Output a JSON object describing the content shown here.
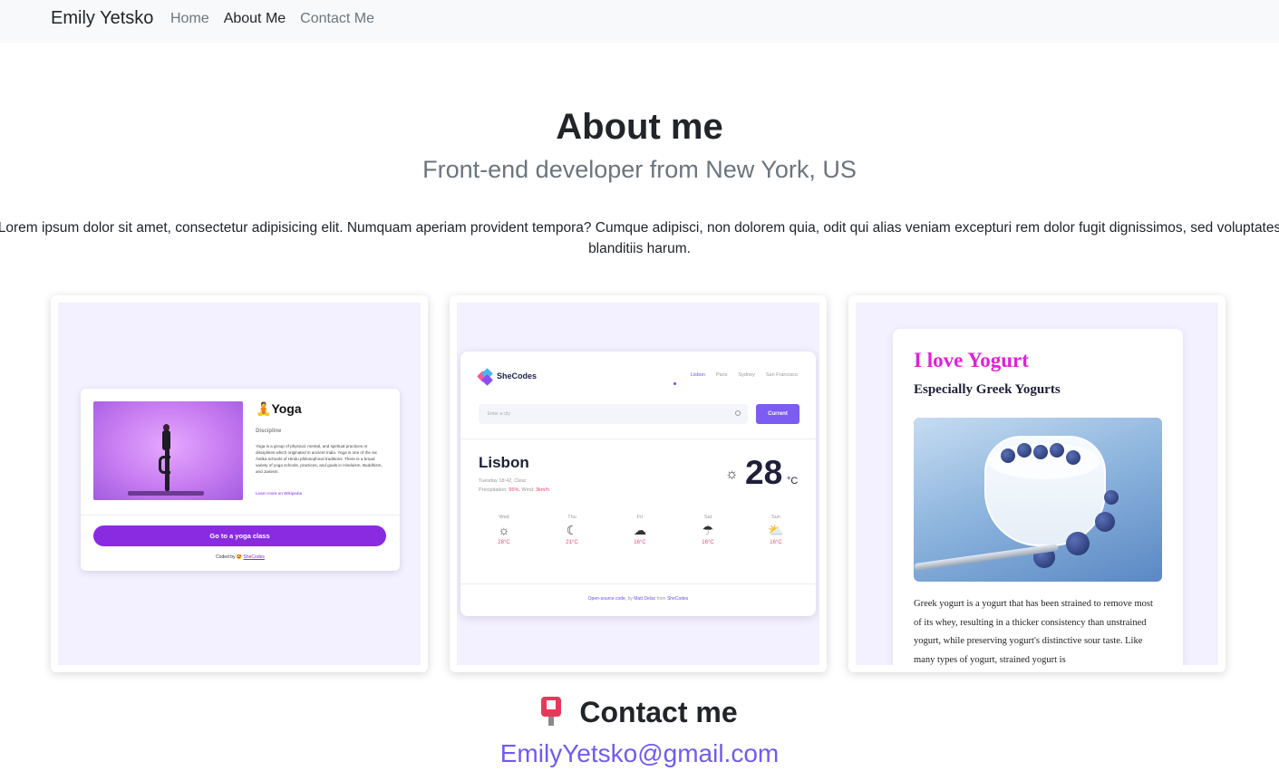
{
  "nav": {
    "brand": "Emily Yetsko",
    "links": [
      {
        "label": "Home"
      },
      {
        "label": "About Me"
      },
      {
        "label": "Contact Me"
      }
    ]
  },
  "about": {
    "title": "About me",
    "subtitle": "Front-end developer from New York, US",
    "text": "Lorem ipsum dolor sit amet, consectetur adipisicing elit. Numquam aperiam provident tempora? Cumque adipisci, non dolorem quia, odit qui alias veniam excepturi rem dolor fugit dignissimos, sed voluptates\nblanditiis harum."
  },
  "projects": {
    "yoga": {
      "title": "Yoga",
      "emoji": "🧘",
      "discipline": "Discipline",
      "description": "Yoga is a group of physical, mental, and spiritual practices or disciplines which originated in ancient India. Yoga is one of the six Āstika schools of Hindu philosophical traditions. There is a broad variety of yoga schools, practices, and goals in Hinduism, Buddhism, and Jainism.",
      "link": "Learn more on Wikipedia",
      "button": "Go to a yoga class",
      "coded_by": "Coded by",
      "coded_emoji": "🤩",
      "coded_link": "SheCodes"
    },
    "weather": {
      "brand": "SheCodes",
      "cities": [
        "Lisbon",
        "Paris",
        "Sydney",
        "San Francisco"
      ],
      "search_placeholder": "Enter a city",
      "current_button": "Current",
      "city": "Lisbon",
      "date_line": "Tuesday 18:42, Clear",
      "precip_label": "Precipitation:",
      "precip_value": "65%",
      "wind_label": ", Wind:",
      "wind_value": "3km/h",
      "temp": "28",
      "unit": "°C",
      "forecast": [
        {
          "day": "Wed",
          "icon": "☼",
          "temp": "28°C"
        },
        {
          "day": "Thu",
          "icon": "☾",
          "temp": "21°C"
        },
        {
          "day": "Fri",
          "icon": "☁",
          "temp": "16°C"
        },
        {
          "day": "Sat",
          "icon": "☂",
          "temp": "16°C"
        },
        {
          "day": "Sun",
          "icon": "⛅",
          "temp": "16°C"
        }
      ],
      "footer_a": "Open-source code",
      "footer_b": ", by ",
      "footer_c": "Matt Delac",
      "footer_d": " from ",
      "footer_e": "SheCodes"
    },
    "yogurt": {
      "title": "I love Yogurt",
      "subtitle": "Especially Greek Yogurts",
      "text": "Greek yogurt is a yogurt that has been strained to remove most of its whey, resulting in a thicker consistency than unstrained yogurt, while preserving yogurt's distinctive sour taste. Like many types of yogurt, strained yogurt is"
    }
  },
  "contact": {
    "title": "Contact me",
    "email": "EmilyYetsko@gmail.com"
  },
  "colors": {
    "accent": "#6f5cf2",
    "navbar_bg": "#f8f9fa",
    "yoga_button": "#8a2be2",
    "yogurt_title": "#e021d8"
  }
}
